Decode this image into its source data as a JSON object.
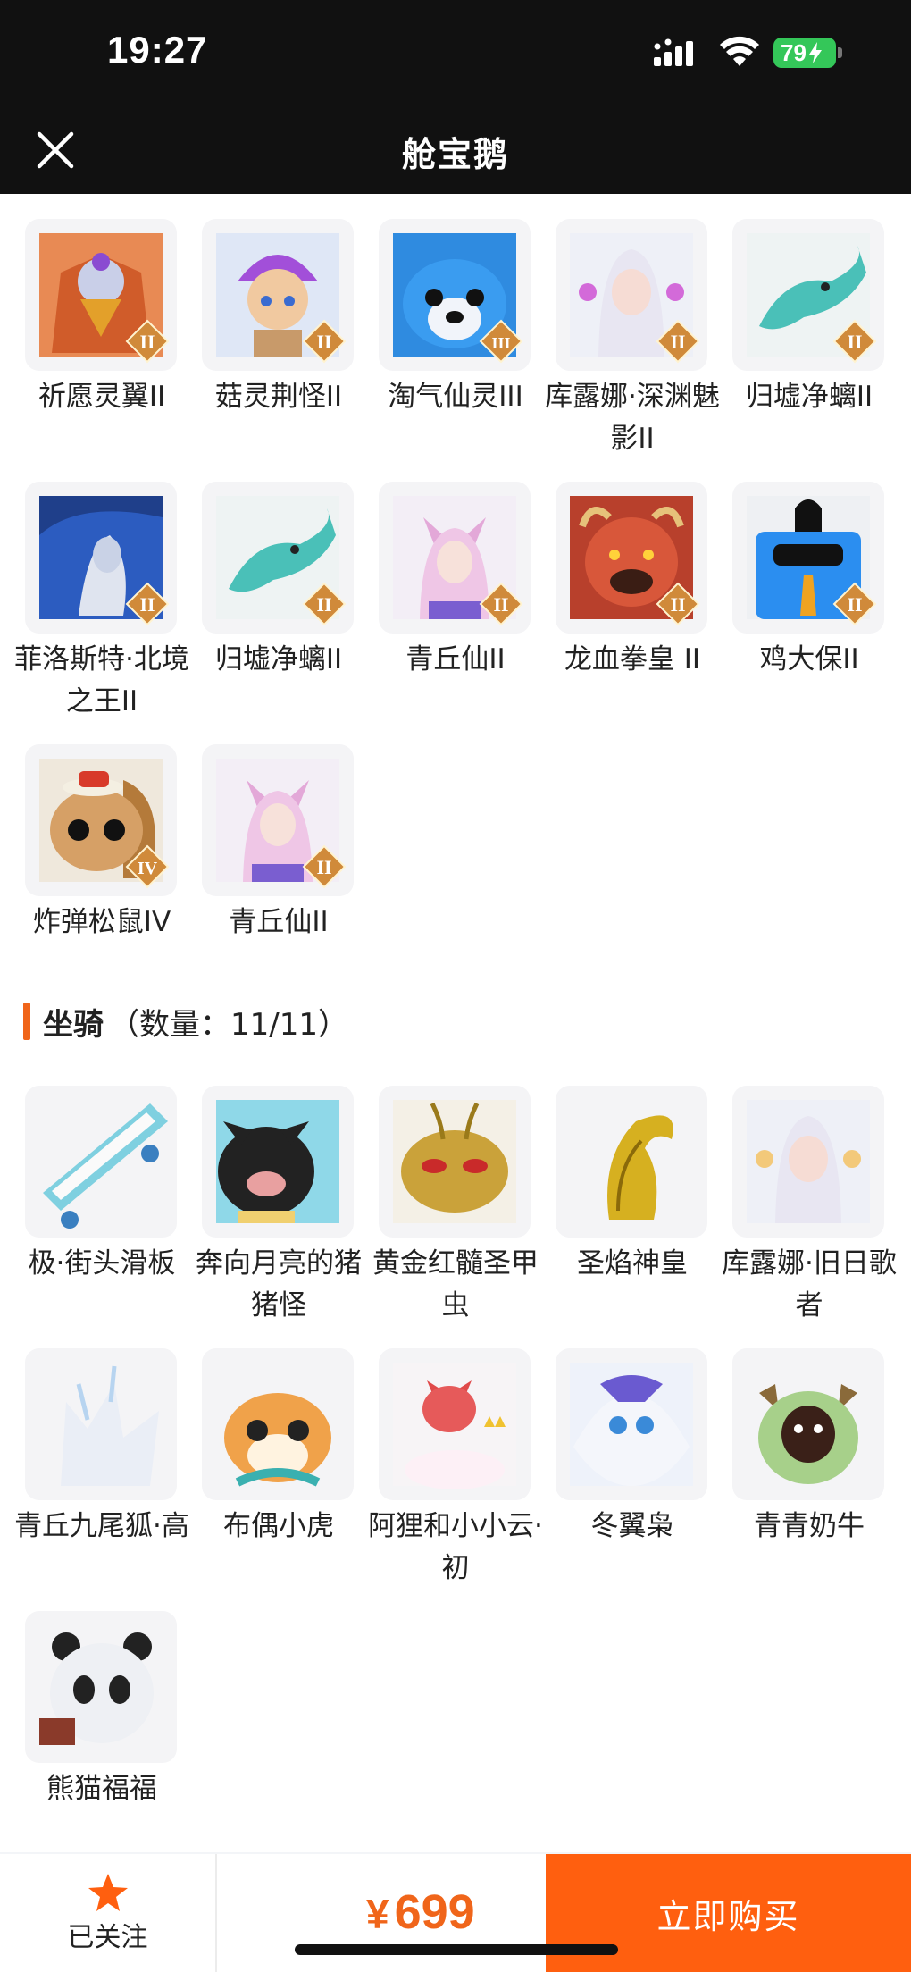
{
  "status_bar": {
    "time": "19:27",
    "battery": "79"
  },
  "nav": {
    "title": "舱宝鹅",
    "close_icon": "close-icon"
  },
  "colors": {
    "accent": "#ff5f0f",
    "price": "#f0651a",
    "badge_gold": "#d08a3a",
    "chrome": "#111111"
  },
  "pets": {
    "items": [
      {
        "name": "祈愿灵翼II",
        "rank": "II"
      },
      {
        "name": "菇灵荆怪II",
        "rank": "II"
      },
      {
        "name": "淘气仙灵III",
        "rank": "III"
      },
      {
        "name": "库露娜·深渊魅影II",
        "rank": "II"
      },
      {
        "name": "归墟净螭II",
        "rank": "II"
      },
      {
        "name": "菲洛斯特·北境之王II",
        "rank": "II"
      },
      {
        "name": "归墟净螭II",
        "rank": "II"
      },
      {
        "name": "青丘仙II",
        "rank": "II"
      },
      {
        "name": "龙血拳皇 II",
        "rank": "II"
      },
      {
        "name": "鸡大保II",
        "rank": "II"
      },
      {
        "name": "炸弹松鼠IV",
        "rank": "IV"
      },
      {
        "name": "青丘仙II",
        "rank": "II"
      }
    ]
  },
  "mounts": {
    "title": "坐骑",
    "count_label": "（数量：11/11）",
    "items": [
      {
        "name": "极·街头滑板"
      },
      {
        "name": "奔向月亮的猪猪怪"
      },
      {
        "name": "黄金红髓圣甲虫"
      },
      {
        "name": "圣焰神皇"
      },
      {
        "name": "库露娜·旧日歌者"
      },
      {
        "name": "青丘九尾狐·高"
      },
      {
        "name": "布偶小虎"
      },
      {
        "name": "阿狸和小小云·初"
      },
      {
        "name": "冬翼枭"
      },
      {
        "name": "青青奶牛"
      },
      {
        "name": "熊猫福福"
      }
    ]
  },
  "bottom_bar": {
    "follow_label": "已关注",
    "follow_icon": "star-icon",
    "price_symbol": "¥",
    "price": "699",
    "buy_label": "立即购买"
  }
}
